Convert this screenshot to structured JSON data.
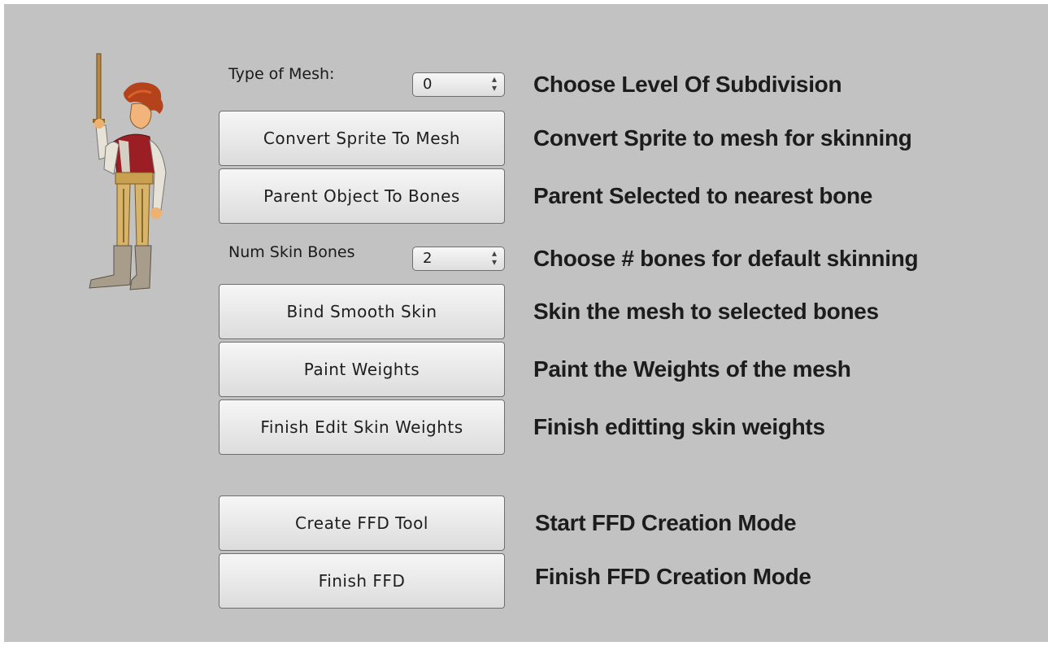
{
  "controls": {
    "type_of_mesh": {
      "label": "Type of Mesh:",
      "value": "0",
      "description": "Choose Level Of Subdivision"
    },
    "num_skin_bones": {
      "label": "Num Skin Bones",
      "value": "2",
      "description": "Choose # bones for default skinning"
    }
  },
  "buttons": [
    {
      "label": "Convert Sprite To Mesh",
      "description": "Convert Sprite to mesh for skinning"
    },
    {
      "label": "Parent Object To Bones",
      "description": "Parent Selected to nearest bone"
    },
    {
      "label": "Bind Smooth Skin",
      "description": "Skin the mesh to selected bones"
    },
    {
      "label": "Paint Weights",
      "description": "Paint the Weights of the mesh"
    },
    {
      "label": "Finish Edit Skin Weights",
      "description": "Finish editting skin weights"
    },
    {
      "label": "Create FFD Tool",
      "description": "Start FFD Creation Mode"
    },
    {
      "label": "Finish FFD",
      "description": "Finish FFD Creation Mode"
    }
  ],
  "icons": {
    "character": "character-sprite-icon",
    "dropdown_arrows": "up-down-arrows-icon"
  },
  "colors": {
    "panel_bg": "#c2c2c2",
    "button_bg": "#e8e8e8",
    "button_border": "#6e6e6e",
    "text": "#1c1c1c"
  }
}
